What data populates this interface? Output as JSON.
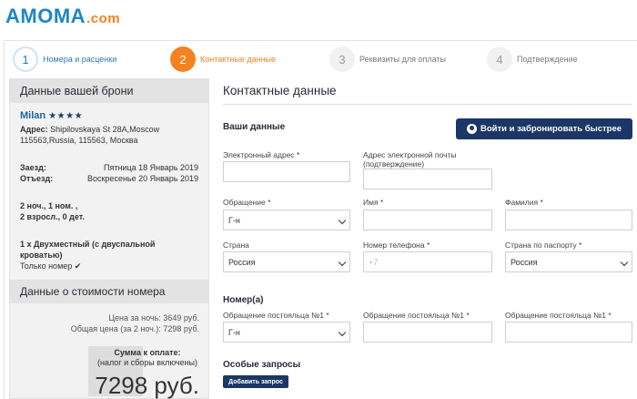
{
  "logo": {
    "brand": "AMOMA",
    "tld": ".com"
  },
  "steps": [
    {
      "num": "1",
      "label": "Номера и расценки"
    },
    {
      "num": "2",
      "label": "Контактные данные"
    },
    {
      "num": "3",
      "label": "Реквизиты для оплаты"
    },
    {
      "num": "4",
      "label": "Подтверждение"
    }
  ],
  "sidebar": {
    "title": "Данные вашей брони",
    "hotel_name": "Milan",
    "stars": "★★★★",
    "address_label": "Адрес:",
    "address": "Shipilovskaya St 28A,Moscow 115563,Russia, 115563, Москва",
    "checkin_label": "Заезд:",
    "checkin": "Пятница 18 Январь 2019",
    "checkout_label": "Отъезд:",
    "checkout": "Воскресенье 20 Январь 2019",
    "nights": "2 ноч., 1 ном. ,",
    "guests": "2 взросл., 0 дет.",
    "room": "1 x Двухместный (с двуспальной кроватью)",
    "room_only": "Только номер",
    "price_title": "Данные о стоимости номера",
    "per_night": "Цена за ночь: 3649 руб.",
    "total_nights": "Общая цена (за 2 ноч.): 7298 руб.",
    "pay_label": "Сумма к оплате:",
    "pay_note": "(налог и сборы включены)",
    "pay_total": "7298 руб."
  },
  "main": {
    "title": "Контактные данные",
    "your_data": "Ваши данные",
    "fast_button": "Войти и забронировать быстрее",
    "email_label": "Электронный адрес *",
    "email_confirm_label": "Адрес электронной почты (подтверждение)",
    "salutation_label": "Обращение *",
    "salutation_value": "Г-н",
    "first_name_label": "Имя *",
    "last_name_label": "Фамилия *",
    "country_label": "Страна",
    "country_value": "Россия",
    "phone_label": "Номер телефона *",
    "phone_placeholder": "+7",
    "passport_label": "Страна по паспорту *",
    "passport_value": "Россия",
    "rooms_title": "Номер(а)",
    "guest_salutation_label": "Обращение постояльца №1 *",
    "guest_salutation_value": "Г-н",
    "special_title": "Особые запросы",
    "add_request": "Добавить запрос"
  }
}
